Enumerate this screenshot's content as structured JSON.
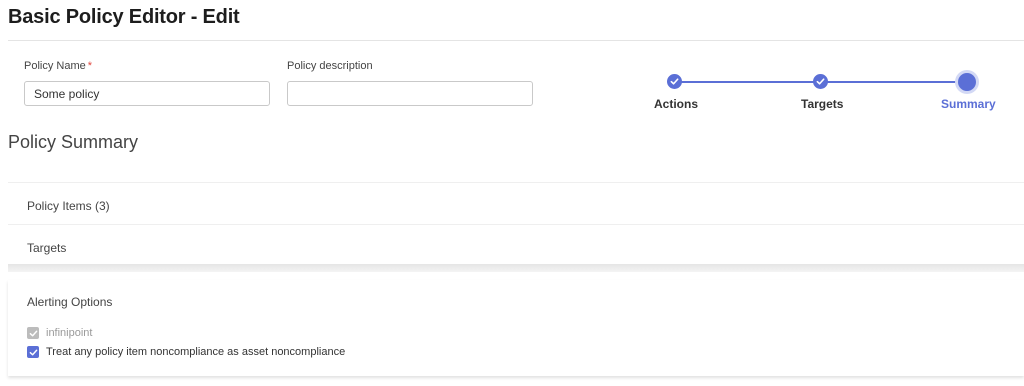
{
  "header": {
    "title": "Basic Policy Editor - Edit"
  },
  "form": {
    "policy_name_label": "Policy Name",
    "required_marker": "*",
    "policy_name_value": "Some policy",
    "policy_description_label": "Policy description",
    "policy_description_value": ""
  },
  "stepper": {
    "accent_color": "#5b6fd6",
    "steps": [
      {
        "label": "Actions",
        "state": "done"
      },
      {
        "label": "Targets",
        "state": "done"
      },
      {
        "label": "Summary",
        "state": "current"
      }
    ]
  },
  "summary": {
    "title": "Policy Summary",
    "policy_items_label": "Policy Items (3)",
    "targets_label": "Targets",
    "alerting": {
      "title": "Alerting Options",
      "options": [
        {
          "label": "infinipoint",
          "checked": true,
          "disabled": true
        },
        {
          "label": "Treat any policy item noncompliance as asset noncompliance",
          "checked": true,
          "disabled": false
        }
      ]
    }
  }
}
